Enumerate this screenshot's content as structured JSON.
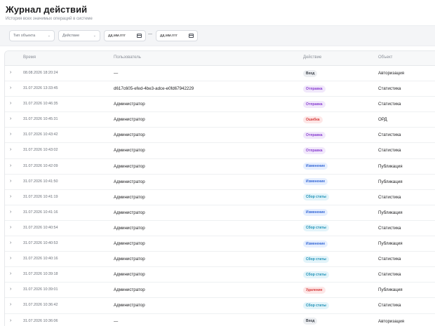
{
  "header": {
    "title": "Журнал действий",
    "subtitle": "История всех значимых операций в системе"
  },
  "filters": {
    "object_type": "Тип объекта",
    "action": "Действие",
    "date_from": "дд.мм.гггг",
    "separator": "—",
    "date_to": "дд.мм.гггг"
  },
  "table": {
    "columns": [
      "Время",
      "Пользователь",
      "Действие",
      "Объект"
    ],
    "rows": [
      {
        "time": "08.08.2026 18:20:24",
        "user": "—",
        "action": "Вход",
        "object": "Авторизация"
      },
      {
        "time": "31.07.2026 13:33:45",
        "user": "d617c605-efed-4be3-adce-e0fd67942229",
        "action": "Отправка",
        "object": "Статистика"
      },
      {
        "time": "31.07.2026 10:46:35",
        "user": "Администратор",
        "action": "Отправка",
        "object": "Статистика"
      },
      {
        "time": "31.07.2026 10:45:31",
        "user": "Администратор",
        "action": "Ошибка",
        "object": "ОРД"
      },
      {
        "time": "31.07.2026 10:43:42",
        "user": "Администратор",
        "action": "Отправка",
        "object": "Статистика"
      },
      {
        "time": "31.07.2026 10:43:02",
        "user": "Администратор",
        "action": "Отправка",
        "object": "Статистика"
      },
      {
        "time": "31.07.2026 10:42:09",
        "user": "Администратор",
        "action": "Изменение",
        "object": "Публикация"
      },
      {
        "time": "31.07.2026 10:41:50",
        "user": "Администратор",
        "action": "Изменение",
        "object": "Публикация"
      },
      {
        "time": "31.07.2026 10:41:19",
        "user": "Администратор",
        "action": "Сбор статы",
        "object": "Статистика"
      },
      {
        "time": "31.07.2026 10:41:16",
        "user": "Администратор",
        "action": "Изменение",
        "object": "Публикация"
      },
      {
        "time": "31.07.2026 10:40:54",
        "user": "Администратор",
        "action": "Сбор статы",
        "object": "Статистика"
      },
      {
        "time": "31.07.2026 10:40:53",
        "user": "Администратор",
        "action": "Изменение",
        "object": "Публикация"
      },
      {
        "time": "31.07.2026 10:40:16",
        "user": "Администратор",
        "action": "Сбор статы",
        "object": "Статистика"
      },
      {
        "time": "31.07.2026 10:39:18",
        "user": "Администратор",
        "action": "Сбор статы",
        "object": "Статистика"
      },
      {
        "time": "31.07.2026 10:39:01",
        "user": "Администратор",
        "action": "Удаление",
        "object": "Публикация"
      },
      {
        "time": "31.07.2026 10:36:42",
        "user": "Администратор",
        "action": "Сбор статы",
        "object": "Статистика"
      },
      {
        "time": "31.07.2026 10:36:06",
        "user": "—",
        "action": "Вход",
        "object": "Авторизация"
      }
    ]
  },
  "badge_colors": {
    "Вход": {
      "bg": "#eceef1",
      "fg": "#3a3f47"
    },
    "Отправка": {
      "bg": "#f1e8fb",
      "fg": "#8a3fd1"
    },
    "Ошибка": {
      "bg": "#fde7e7",
      "fg": "#d63b3b"
    },
    "Изменение": {
      "bg": "#e6efff",
      "fg": "#3467d6"
    },
    "Сбор статы": {
      "bg": "#e3f4fa",
      "fg": "#1b8fb5"
    },
    "Удаление": {
      "bg": "#fde7e7",
      "fg": "#d63b3b"
    }
  },
  "icons": {
    "row_expand": "chevron-right-icon",
    "select": "chevron-down-icon",
    "date": "calendar-icon"
  }
}
